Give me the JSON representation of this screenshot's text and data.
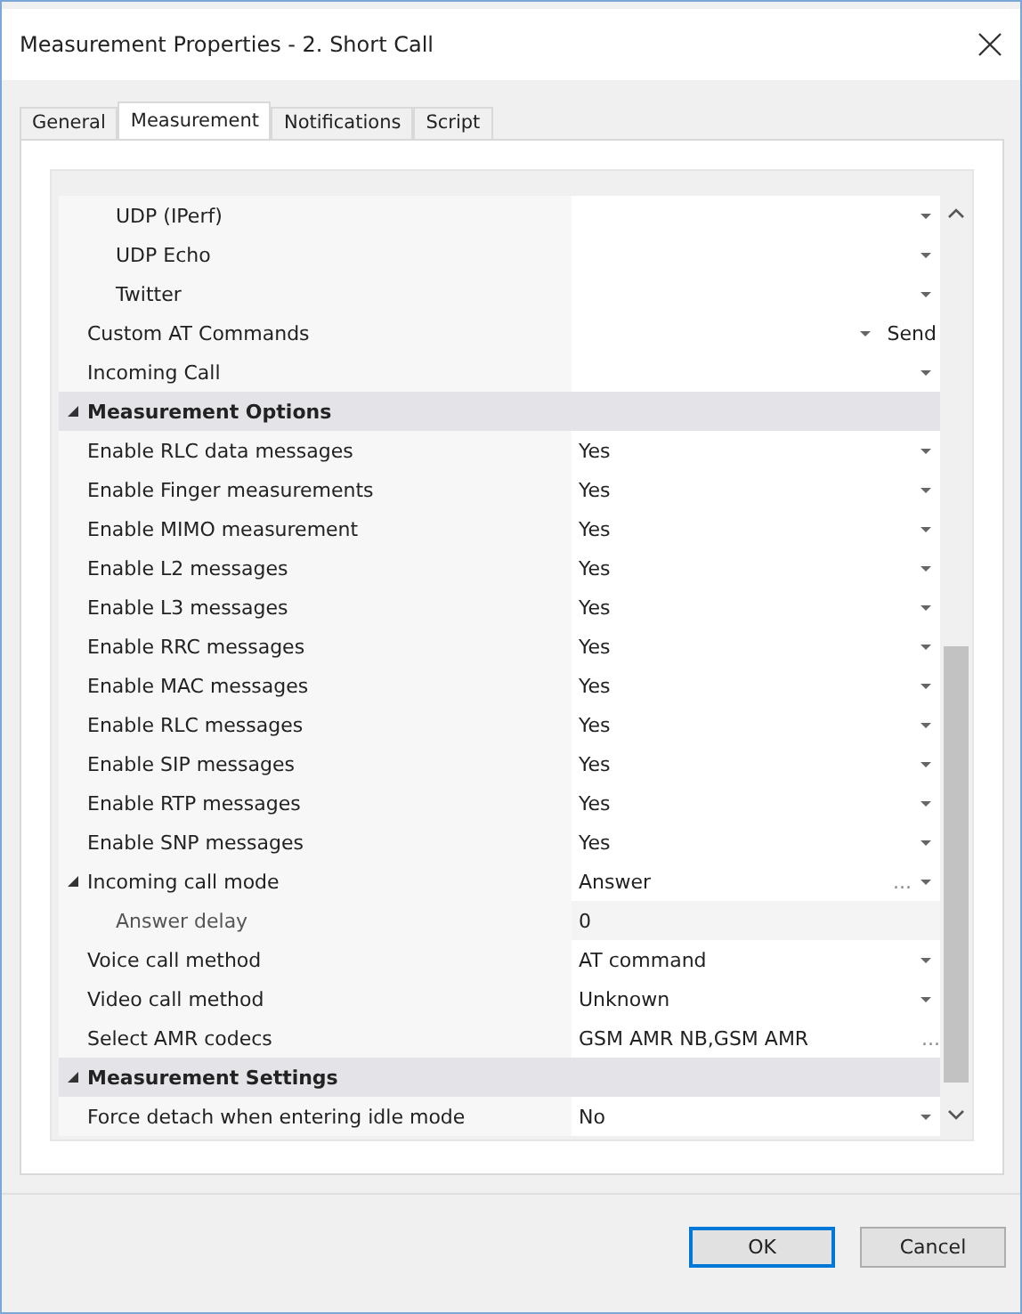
{
  "window": {
    "title": "Measurement Properties - 2. Short Call"
  },
  "tabs": [
    {
      "label": "General",
      "selected": false
    },
    {
      "label": "Measurement",
      "selected": true
    },
    {
      "label": "Notifications",
      "selected": false
    },
    {
      "label": "Script",
      "selected": false
    }
  ],
  "properties": [
    {
      "kind": "group",
      "children": [
        {
          "kind": "group",
          "children": [
            {
              "kind": "item",
              "name": "UDP (IPerf)",
              "dropdown": true
            },
            {
              "kind": "item",
              "name": "UDP Echo",
              "dropdown": true
            },
            {
              "kind": "item",
              "name": "Twitter",
              "dropdown": true
            }
          ]
        },
        {
          "kind": "item",
          "name": "Custom AT Commands",
          "dropdown": true,
          "button": "Send"
        },
        {
          "kind": "item",
          "name": "Incoming Call",
          "dropdown": true
        }
      ]
    },
    {
      "kind": "category",
      "name": "Measurement Options",
      "expanded": true,
      "children": [
        {
          "kind": "item",
          "name": "Enable RLC data messages",
          "value": "Yes",
          "dropdown": true
        },
        {
          "kind": "item",
          "name": "Enable Finger measurements",
          "value": "Yes",
          "dropdown": true
        },
        {
          "kind": "item",
          "name": "Enable MIMO measurement",
          "value": "Yes",
          "dropdown": true
        },
        {
          "kind": "item",
          "name": "Enable L2 messages",
          "value": "Yes",
          "dropdown": true
        },
        {
          "kind": "item",
          "name": "Enable L3 messages",
          "value": "Yes",
          "dropdown": true
        },
        {
          "kind": "item",
          "name": "Enable RRC messages",
          "value": "Yes",
          "dropdown": true
        },
        {
          "kind": "item",
          "name": "Enable MAC messages",
          "value": "Yes",
          "dropdown": true
        },
        {
          "kind": "item",
          "name": "Enable RLC messages",
          "value": "Yes",
          "dropdown": true
        },
        {
          "kind": "item",
          "name": "Enable SIP messages",
          "value": "Yes",
          "dropdown": true
        },
        {
          "kind": "item",
          "name": "Enable RTP messages",
          "value": "Yes",
          "dropdown": true
        },
        {
          "kind": "item",
          "name": "Enable SNP messages",
          "value": "Yes",
          "dropdown": true
        },
        {
          "kind": "item",
          "name": "Incoming call mode",
          "value": "Answer",
          "dropdown": true,
          "ellipsis": "...",
          "expanded": true,
          "children": [
            {
              "kind": "item",
              "name": "Answer delay",
              "value": "0",
              "readonly": true
            }
          ]
        },
        {
          "kind": "item",
          "name": "Voice call method",
          "value": "AT command",
          "dropdown": true
        },
        {
          "kind": "item",
          "name": "Video call method",
          "value": "Unknown",
          "dropdown": true
        },
        {
          "kind": "item",
          "name": "Select AMR codecs",
          "value": "GSM AMR NB,GSM AMR",
          "ellipsis": "..."
        }
      ]
    },
    {
      "kind": "category",
      "name": "Measurement Settings",
      "expanded": true,
      "children": [
        {
          "kind": "item",
          "name": "Force detach when entering idle mode",
          "value": "No",
          "dropdown": true
        }
      ]
    }
  ],
  "buttons": [
    {
      "label": "OK",
      "default": true
    },
    {
      "label": "Cancel",
      "default": false
    }
  ]
}
